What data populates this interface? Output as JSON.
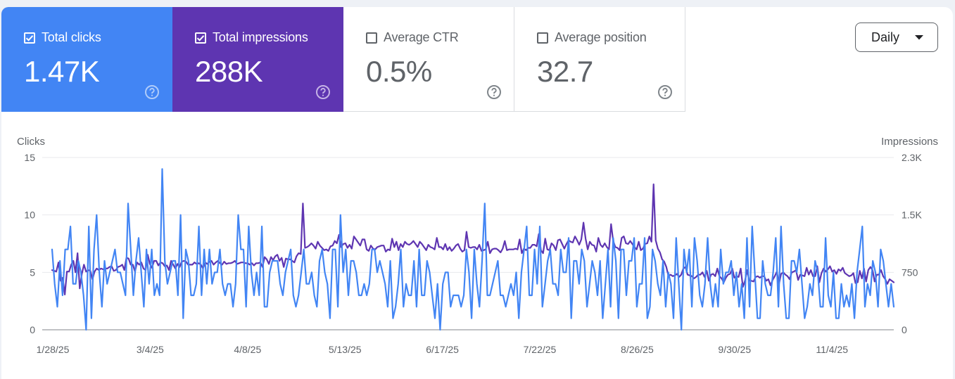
{
  "metrics": [
    {
      "label": "Total clicks",
      "value": "1.47K",
      "checked": true,
      "color": "#4285f4"
    },
    {
      "label": "Total impressions",
      "value": "288K",
      "checked": true,
      "color": "#5e35b1"
    },
    {
      "label": "Average CTR",
      "value": "0.5%",
      "checked": false
    },
    {
      "label": "Average position",
      "value": "32.7",
      "checked": false
    }
  ],
  "period_select": {
    "value": "Daily"
  },
  "chart_data": {
    "type": "line",
    "left_axis": {
      "title": "Clicks",
      "ticks": [
        "0",
        "5",
        "10",
        "15"
      ],
      "range": [
        0,
        15
      ]
    },
    "right_axis": {
      "title": "Impressions",
      "ticks": [
        "0",
        "750",
        "1.5K",
        "2.3K"
      ],
      "range": [
        0,
        2250
      ]
    },
    "x_ticks": [
      "1/28/25",
      "3/4/25",
      "4/8/25",
      "5/13/25",
      "6/17/25",
      "7/22/25",
      "8/26/25",
      "9/30/25",
      "11/4/25"
    ],
    "x_range": [
      "2025-01-28",
      "2025-11-30"
    ],
    "grid": true,
    "series": [
      {
        "name": "Clicks",
        "axis": "left",
        "color": "#4285f4",
        "values": [
          7,
          4,
          2,
          6,
          3,
          7,
          7,
          9,
          4,
          4,
          6,
          5,
          3,
          0,
          9,
          1,
          7,
          10,
          5,
          2,
          6,
          4,
          5,
          6,
          7,
          5,
          5,
          4,
          3,
          11,
          7,
          3,
          6,
          8,
          5,
          2,
          7,
          4,
          7,
          3,
          4,
          3,
          14,
          6,
          4,
          5,
          6,
          6,
          3,
          10,
          1,
          7,
          6,
          3,
          3,
          4,
          9,
          3,
          7,
          4,
          7,
          4,
          5,
          5,
          7,
          4,
          3,
          4,
          4,
          2,
          4,
          10,
          7,
          7,
          2,
          9,
          5,
          3,
          5,
          3,
          9,
          2,
          2,
          5,
          6,
          6,
          6,
          4,
          3,
          5,
          6,
          7,
          3,
          2,
          3,
          5,
          7,
          4,
          4,
          5,
          3,
          2,
          6,
          7,
          5,
          4,
          1,
          7,
          7,
          2,
          10,
          5,
          7,
          3,
          6,
          6,
          5,
          3,
          3,
          4,
          3,
          4,
          7,
          7,
          5,
          6,
          5,
          4,
          2,
          6,
          1,
          2,
          4,
          7,
          2,
          4,
          3,
          3,
          6,
          2,
          7,
          3,
          3,
          6,
          5,
          3,
          1,
          4,
          0,
          4,
          5,
          5,
          2,
          3,
          3,
          3,
          2,
          3,
          7,
          5,
          1,
          7,
          4,
          2,
          6,
          11,
          3,
          3,
          4,
          5,
          6,
          3,
          3,
          2,
          3,
          4,
          3,
          5,
          1,
          5,
          7,
          9,
          3,
          3,
          7,
          4,
          9,
          2,
          4,
          6,
          7,
          4,
          4,
          3,
          7,
          5,
          5,
          8,
          1,
          6,
          6,
          4,
          7,
          6,
          2,
          4,
          6,
          5,
          3,
          6,
          1,
          4,
          7,
          2,
          8,
          6,
          1,
          7,
          7,
          3,
          6,
          6,
          8,
          2,
          4,
          4,
          8,
          1,
          2,
          7,
          6,
          4,
          3,
          6,
          2,
          5,
          4,
          1,
          8,
          4,
          0,
          7,
          5,
          7,
          2,
          8,
          6,
          3,
          2,
          4,
          8,
          4,
          2,
          4,
          2,
          7,
          4,
          5,
          5,
          6,
          3,
          5,
          2,
          4,
          1,
          8,
          2,
          9,
          5,
          1,
          1,
          6,
          4,
          3,
          3,
          5,
          8,
          2,
          9,
          4,
          1,
          1,
          6,
          6,
          5,
          7,
          4,
          1,
          2,
          4,
          3,
          6,
          5,
          2,
          2,
          8,
          3,
          2,
          5,
          1,
          1,
          4,
          2,
          3,
          2,
          4,
          1,
          5,
          7,
          9,
          2,
          4,
          3,
          6,
          5,
          2,
          7,
          6,
          4,
          2,
          4,
          2
        ]
      },
      {
        "name": "Impressions",
        "axis": "right",
        "color": "#5e35b1",
        "values": [
          780,
          770,
          760,
          880,
          640,
          680,
          460,
          760,
          760,
          850,
          900,
          750,
          1000,
          540,
          730,
          850,
          760,
          780,
          770,
          660,
          760,
          800,
          780,
          800,
          790,
          800,
          800,
          820,
          830,
          770,
          780,
          820,
          830,
          850,
          780,
          940,
          930,
          850,
          850,
          760,
          880,
          850,
          880,
          800,
          780,
          980,
          860,
          810,
          900,
          900,
          840,
          880,
          870,
          830,
          840,
          780,
          900,
          850,
          800,
          860,
          820,
          890,
          900,
          890,
          850,
          850,
          850,
          880,
          860,
          870,
          850,
          800,
          880,
          860,
          890,
          900,
          850,
          880,
          900,
          870,
          850,
          890,
          860,
          870,
          870,
          880,
          900,
          860,
          870,
          880,
          880,
          870,
          870,
          850,
          870,
          840,
          870,
          870,
          880,
          820,
          950,
          920,
          860,
          950,
          910,
          960,
          980,
          900,
          940,
          820,
          930,
          920,
          920,
          900,
          880,
          960,
          1000,
          990,
          1650,
          1070,
          1080,
          1100,
          1130,
          1100,
          1060,
          1150,
          1100,
          1070,
          1040,
          1050,
          1030,
          1090,
          1100,
          1160,
          1130,
          1240,
          1080,
          1120,
          1130,
          1070,
          1110,
          1060,
          1220,
          1180,
          1140,
          1100,
          1180,
          1180,
          1050,
          1030,
          1100,
          1060,
          1050,
          1080,
          1090,
          1100,
          1100,
          1020,
          1050,
          1040,
          1190,
          1080,
          1150,
          1040,
          1120,
          1080,
          1150,
          1120,
          1110,
          1130,
          1160,
          1120,
          1080,
          1150,
          1120,
          1080,
          1040,
          1110,
          1080,
          1070,
          1050,
          1200,
          1080,
          1080,
          1050,
          1120,
          1040,
          1080,
          1030,
          1060,
          1100,
          1120,
          1060,
          1020,
          1040,
          1280,
          1080,
          1070,
          1080,
          1080,
          1050,
          1110,
          1030,
          1040,
          1050,
          1150,
          1000,
          1050,
          1060,
          1060,
          1040,
          1010,
          1060,
          1160,
          1040,
          1050,
          1050,
          1050,
          1060,
          1050,
          1180,
          1000,
          1060,
          1040,
          1070,
          1070,
          1110,
          1110,
          1090,
          1250,
          1040,
          1000,
          1190,
          1050,
          1040,
          1130,
          1100,
          1040,
          1170,
          1180,
          1120,
          1060,
          1120,
          1170,
          1150,
          1140,
          1220,
          1170,
          1110,
          1180,
          1400,
          1190,
          1050,
          1150,
          1110,
          1100,
          1020,
          1200,
          1110,
          1080,
          1130,
          1080,
          1050,
          1380,
          1160,
          1080,
          1070,
          1040,
          1200,
          1220,
          1130,
          1120,
          1160,
          1120,
          1080,
          1050,
          1150,
          1040,
          1060,
          1120,
          1130,
          1220,
          1150,
          1900,
          1170,
          1060,
          1010,
          920,
          890,
          820,
          700,
          720,
          700,
          710,
          730,
          690,
          720,
          800,
          820,
          720,
          710,
          700,
          670,
          690,
          720,
          720,
          750,
          690,
          770,
          640,
          720,
          730,
          700,
          800,
          700,
          670,
          620,
          680,
          720,
          730,
          800,
          680,
          700,
          690,
          800,
          560,
          640,
          780,
          640,
          640,
          630,
          690,
          700,
          680,
          700,
          700,
          640,
          660,
          580,
          650,
          700,
          760,
          600,
          730,
          750,
          720,
          700,
          660,
          750,
          760,
          780,
          650,
          720,
          710,
          700,
          810,
          720,
          780,
          700,
          700,
          830,
          620,
          740,
          800,
          760,
          790,
          830,
          760,
          780,
          730,
          790,
          770,
          810,
          740,
          720,
          700,
          710,
          740,
          610,
          620,
          770,
          670,
          800,
          630,
          780,
          820,
          780,
          630,
          720,
          720,
          780,
          700,
          660,
          600,
          660,
          640,
          620
        ]
      }
    ]
  }
}
